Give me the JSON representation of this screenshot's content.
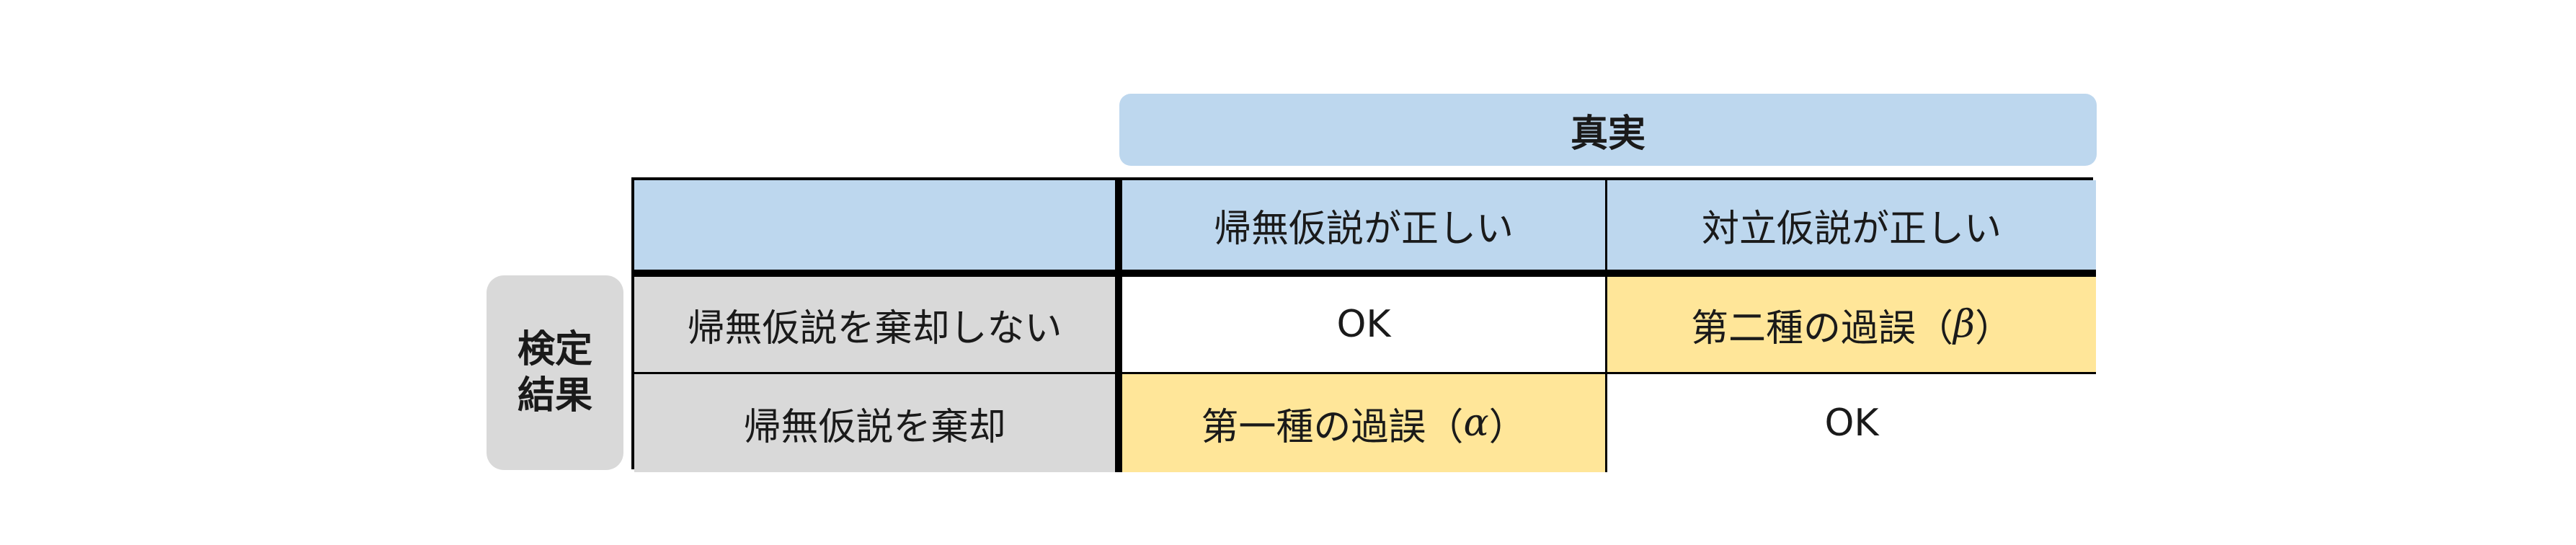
{
  "truth_header": "真実",
  "result_label": {
    "line1": "検定",
    "line2": "結果"
  },
  "table": {
    "columns": [
      "",
      "帰無仮説が正しい",
      "対立仮説が正しい"
    ],
    "rows": [
      {
        "label": "帰無仮説を棄却しない",
        "cells": [
          {
            "text": "OK"
          },
          {
            "prefix": "第二種の過誤（",
            "greek": "β",
            "suffix": "）"
          }
        ]
      },
      {
        "label": "帰無仮説を棄却",
        "cells": [
          {
            "prefix": "第一種の過誤（",
            "greek": "α",
            "suffix": "）"
          },
          {
            "text": "OK"
          }
        ]
      }
    ]
  },
  "colors": {
    "header_blue": "#bdd7ee",
    "label_gray": "#d9d9d9",
    "error_yellow": "#ffe699"
  }
}
